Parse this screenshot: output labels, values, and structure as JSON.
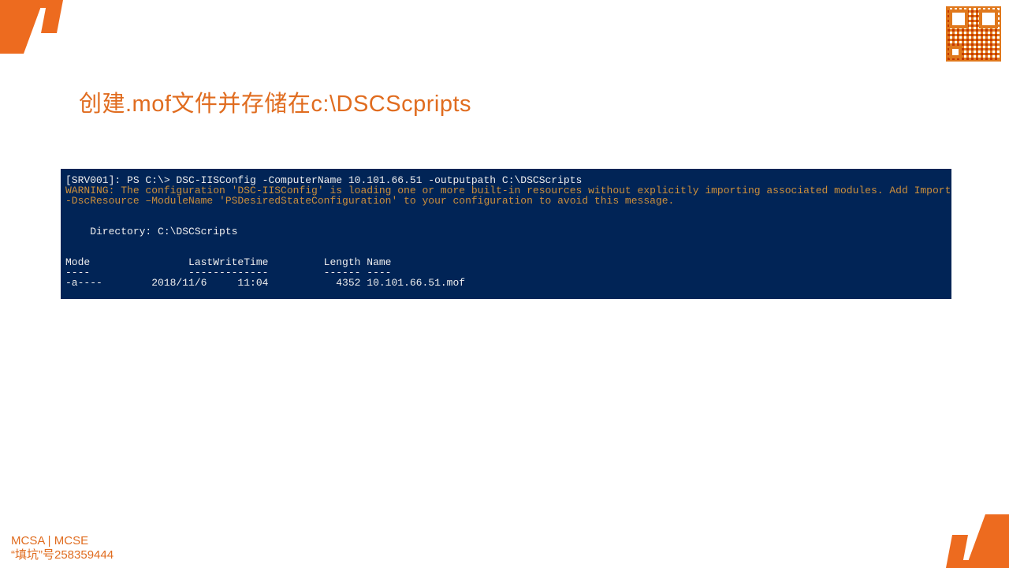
{
  "title": "创建.mof文件并存储在c:\\DSCScpripts",
  "terminal": {
    "line1": "[SRV001]: PS C:\\> DSC-IISConfig -ComputerName 10.101.66.51 -outputpath C:\\DSCScripts",
    "warn1": "WARNING: The configuration 'DSC-IISConfig' is loading one or more built-in resources without explicitly importing associated modules. Add Import",
    "warn2": "-DscResource –ModuleName 'PSDesiredStateConfiguration' to your configuration to avoid this message.",
    "dir": "    Directory: C:\\DSCScripts",
    "hdr": "Mode                LastWriteTime         Length Name",
    "sep": "----                -------------         ------ ----",
    "row": "-a----        2018/11/6     11:04           4352 10.101.66.51.mof"
  },
  "footer": {
    "line1": "MCSA | MCSE",
    "line2": "“填坑”号258359444"
  }
}
